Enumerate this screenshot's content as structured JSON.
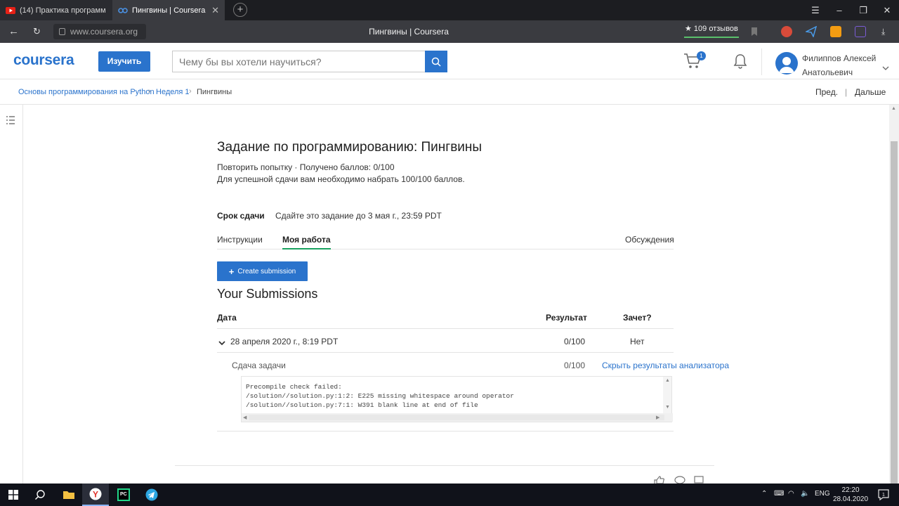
{
  "browser": {
    "tabs": [
      {
        "title": "(14) Практика программ",
        "active": false
      },
      {
        "title": "Пингвины | Coursera",
        "active": true
      }
    ],
    "url": "www.coursera.org",
    "page_title": "Пингвины | Coursera",
    "reviews": "★ 109 отзывов"
  },
  "header": {
    "logo": "coursera",
    "learn_button": "Изучить",
    "search_placeholder": "Чему бы вы хотели научиться?",
    "cart_count": "1",
    "user_line1": "Филиппов Алексей",
    "user_line2": "Анатольевич"
  },
  "breadcrumb": {
    "items": [
      "Основы программирования на Python",
      "Неделя 1",
      "Пингвины"
    ],
    "prev": "Пред.",
    "next": "Дальше"
  },
  "assignment": {
    "title": "Задание по программированию: Пингвины",
    "status": "Повторить попытку · Получено баллов: 0/100",
    "requirement": "Для успешной сдачи вам необходимо набрать 100/100 баллов.",
    "due_label": "Срок сдачи",
    "due_text": "Сдайте это задание до 3 мая г., 23:59 PDT",
    "tabs": [
      "Инструкции",
      "Моя работа",
      "Обсуждения"
    ],
    "create_button": "Create submission",
    "submissions_title": "Your Submissions",
    "table_headers": [
      "Дата",
      "Результат",
      "Зачет?"
    ],
    "row": {
      "date": "28 апреля 2020 г., 8:19 PDT",
      "score": "0/100",
      "passed": "Нет"
    },
    "subrow": {
      "label": "Сдача задачи",
      "score": "0/100",
      "link": "Скрыть результаты анализатора"
    },
    "log": "Precompile check failed:\n/solution//solution.py:1:2: E225 missing whitespace around operator\n/solution//solution.py:7:1: W391 blank line at end of file"
  },
  "taskbar": {
    "lang": "ENG",
    "time": "22:20",
    "date": "28.04.2020",
    "notifications": "1"
  },
  "colors": {
    "accent": "#2a73cc",
    "tab_underline": "#1aa260"
  }
}
